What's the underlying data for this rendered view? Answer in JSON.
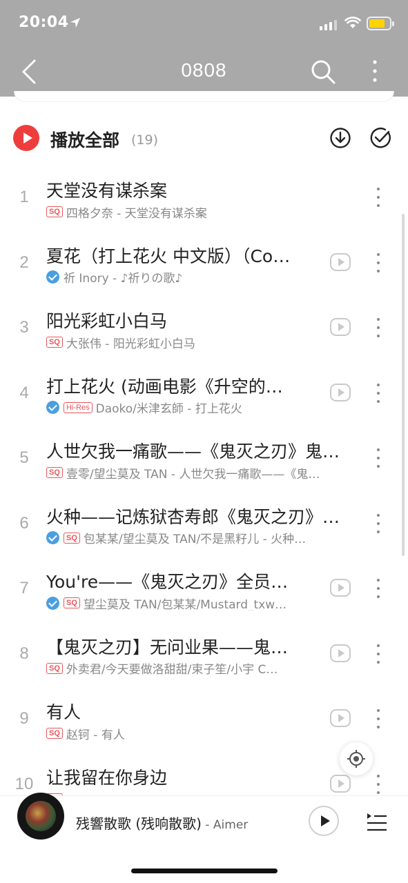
{
  "status_bar": {
    "time": "20:04",
    "battery_level": 0.6,
    "battery_color": "#ffd400"
  },
  "nav": {
    "title": "0808",
    "icons": [
      "back-arrow-icon",
      "search-icon",
      "more-vertical-icon"
    ]
  },
  "playlist_header": {
    "play_all_label": "播放全部",
    "count": "(19)",
    "accent": "#ee3d3d"
  },
  "songs": [
    {
      "index": "1",
      "title": "天堂没有谋杀案",
      "verified": false,
      "badges": [
        "SQ"
      ],
      "meta": "四格夕奈 - 天堂没有谋杀案",
      "has_mv": false
    },
    {
      "index": "2",
      "title": "夏花（打上花火 中文版）（Co…",
      "verified": true,
      "badges": [],
      "meta": "祈 Inory - ♪祈りの歌♪",
      "has_mv": true
    },
    {
      "index": "3",
      "title": "阳光彩虹小白马",
      "verified": false,
      "badges": [
        "SQ"
      ],
      "meta": "大张伟 - 阳光彩虹小白马",
      "has_mv": true
    },
    {
      "index": "4",
      "title": "打上花火 (动画电影《升空的…",
      "verified": true,
      "badges": [
        "Hi-Res"
      ],
      "meta": "Daoko/米津玄師 - 打上花火",
      "has_mv": true
    },
    {
      "index": "5",
      "title": "人世欠我一痛歌——《鬼灭之刃》鬼…",
      "verified": false,
      "badges": [
        "SQ"
      ],
      "meta": "壹零/望尘莫及 TAN - 人世欠我一痛歌——《鬼…",
      "has_mv": false
    },
    {
      "index": "6",
      "title": "火种——记炼狱杏寿郎《鬼灭之刃》…",
      "verified": true,
      "badges": [
        "SQ"
      ],
      "meta": "包某某/望尘莫及 TAN/不是黑籽儿 - 火种…",
      "has_mv": false
    },
    {
      "index": "7",
      "title": "You're——《鬼灭之刃》全员…",
      "verified": true,
      "badges": [
        "SQ"
      ],
      "meta": "望尘莫及 TAN/包某某/Mustard_txw…",
      "has_mv": true
    },
    {
      "index": "8",
      "title": "【鬼灭之刃】无问业果——鬼…",
      "verified": false,
      "badges": [
        "SQ"
      ],
      "meta": "外卖君/今天要做洛甜甜/束子笙/小宇 C…",
      "has_mv": true
    },
    {
      "index": "9",
      "title": "有人",
      "verified": false,
      "badges": [
        "SQ"
      ],
      "meta": "赵钶 - 有人",
      "has_mv": true
    },
    {
      "index": "10",
      "title": "让我留在你身边",
      "verified": false,
      "badges": [
        "SQ"
      ],
      "meta": "",
      "has_mv": true
    }
  ],
  "player": {
    "song": "残響散歌 (残响散歌)",
    "artist_sep": " - ",
    "artist": "Aimer",
    "is_playing": false
  }
}
